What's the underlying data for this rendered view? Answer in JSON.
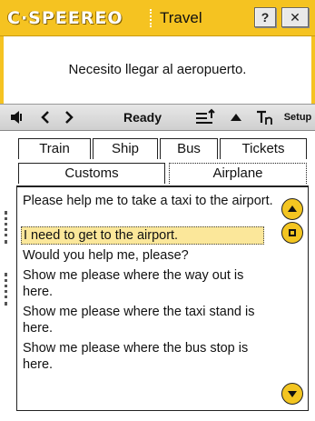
{
  "app": {
    "logo": "C·SPEEREO",
    "title": "Travel",
    "help_label": "?",
    "close_label": "✕"
  },
  "display": {
    "text": "Necesito llegar al aeropuerto."
  },
  "toolbar": {
    "status": "Ready",
    "setup_label": "Setup"
  },
  "tabs": {
    "row1": [
      "Train",
      "Ship",
      "Bus",
      "Tickets"
    ],
    "row2": [
      "Customs",
      "Airplane"
    ],
    "active": "Airplane"
  },
  "phrases": [
    "Please help me to take a taxi to the airport.",
    "I need to get to the airport.",
    "Would you help me, please?",
    "Show me please where the way out is here.",
    "Show me please where the taxi stand is here.",
    "Show me please where the bus stop is here."
  ],
  "selected_phrase": 1,
  "colors": {
    "accent": "#f5c321",
    "selection": "#fbe79a"
  },
  "icons": [
    "speaker-icon",
    "back-icon",
    "forward-icon",
    "sort-icon",
    "up-arrow-icon",
    "translate-icon",
    "scroll-up-icon",
    "stop-icon",
    "scroll-down-icon"
  ]
}
